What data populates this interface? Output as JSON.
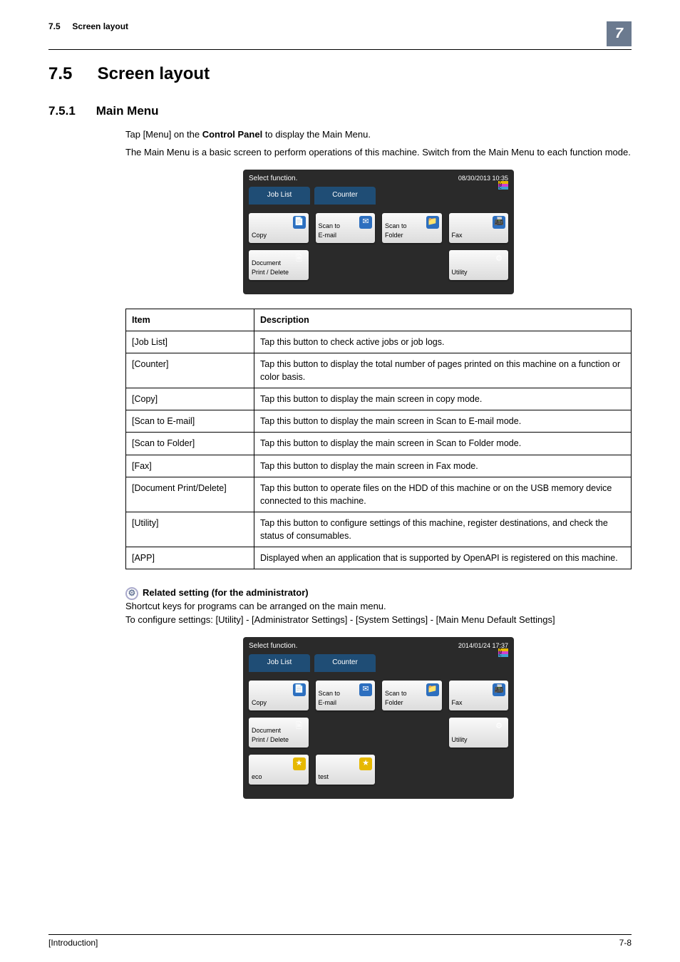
{
  "running_head": {
    "section_no": "7.5",
    "section_title": "Screen layout",
    "chapter_badge": "7"
  },
  "h1": {
    "number": "7.5",
    "title": "Screen layout"
  },
  "h2": {
    "number": "7.5.1",
    "title": "Main Menu"
  },
  "intro": {
    "p1_a": "Tap [Menu] on the ",
    "p1_b": "Control Panel",
    "p1_c": " to display the Main Menu.",
    "p2": "The Main Menu is a basic screen to perform operations of this machine. Switch from the Main Menu to each function mode."
  },
  "screen1": {
    "prompt": "Select function.",
    "datetime": "08/30/2013 10:35",
    "tab_joblist": "Job List",
    "tab_counter": "Counter",
    "tiles": {
      "copy": "Copy",
      "scan_email": "Scan to\nE-mail",
      "scan_folder": "Scan to\nFolder",
      "fax": "Fax",
      "doc_print": "Document\nPrint / Delete",
      "utility": "Utility"
    }
  },
  "table": {
    "head_item": "Item",
    "head_desc": "Description",
    "rows": [
      {
        "item": "[Job List]",
        "desc": "Tap this button to check active jobs or job logs."
      },
      {
        "item": "[Counter]",
        "desc": "Tap this button to display the total number of pages printed on this machine on a function or color basis."
      },
      {
        "item": "[Copy]",
        "desc": "Tap this button to display the main screen in copy mode."
      },
      {
        "item": "[Scan to E-mail]",
        "desc": "Tap this button to display the main screen in Scan to E-mail mode."
      },
      {
        "item": "[Scan to Folder]",
        "desc": "Tap this button to display the main screen in Scan to Folder mode."
      },
      {
        "item": "[Fax]",
        "desc": "Tap this button to display the main screen in Fax mode."
      },
      {
        "item": "[Document Print/Delete]",
        "desc": "Tap this button to operate files on the HDD of this machine or on the USB memory device connected to this machine."
      },
      {
        "item": "[Utility]",
        "desc": "Tap this button to configure settings of this machine, register destinations, and check the status of consumables."
      },
      {
        "item": "[APP]",
        "desc": "Displayed when an application that is supported by OpenAPI is registered on this machine."
      }
    ]
  },
  "related": {
    "heading": "Related setting (for the administrator)",
    "p1": "Shortcut keys for programs can be arranged on the main menu.",
    "p2": "To configure settings: [Utility] - [Administrator Settings] - [System Settings] - [Main Menu Default Settings]"
  },
  "screen2": {
    "prompt": "Select function.",
    "datetime": "2014/01/24 17:37",
    "tab_joblist": "Job List",
    "tab_counter": "Counter",
    "tiles": {
      "copy": "Copy",
      "scan_email": "Scan to\nE-mail",
      "scan_folder": "Scan to\nFolder",
      "fax": "Fax",
      "doc_print": "Document\nPrint / Delete",
      "utility": "Utility",
      "eco": "eco",
      "test": "test"
    }
  },
  "footer": {
    "left": "[Introduction]",
    "right": "7-8"
  }
}
